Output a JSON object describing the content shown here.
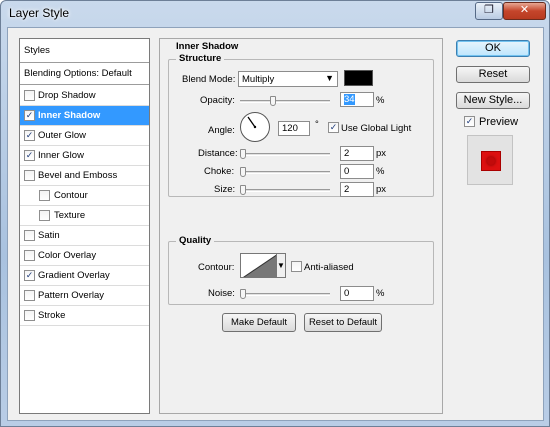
{
  "window": {
    "title": "Layer Style",
    "restore_icon": "restore-icon",
    "close_icon": "close-icon"
  },
  "styles": {
    "header": "Styles",
    "blending": "Blending Options: Default",
    "items": [
      {
        "label": "Drop Shadow",
        "checked": false
      },
      {
        "label": "Inner Shadow",
        "checked": true,
        "selected": true
      },
      {
        "label": "Outer Glow",
        "checked": true
      },
      {
        "label": "Inner Glow",
        "checked": true
      },
      {
        "label": "Bevel and Emboss",
        "checked": false
      },
      {
        "label": "Contour",
        "checked": false,
        "sub": true
      },
      {
        "label": "Texture",
        "checked": false,
        "sub": true
      },
      {
        "label": "Satin",
        "checked": false
      },
      {
        "label": "Color Overlay",
        "checked": false
      },
      {
        "label": "Gradient Overlay",
        "checked": true
      },
      {
        "label": "Pattern Overlay",
        "checked": false
      },
      {
        "label": "Stroke",
        "checked": false
      }
    ]
  },
  "panel": {
    "title": "Inner Shadow",
    "structure": {
      "title": "Structure",
      "blend_mode_label": "Blend Mode:",
      "blend_mode_value": "Multiply",
      "blend_color": "#000000",
      "opacity_label": "Opacity:",
      "opacity_value": "34",
      "opacity_unit": "%",
      "angle_label": "Angle:",
      "angle_value": "120",
      "angle_unit": "°",
      "use_global_light": "Use Global Light",
      "use_global_light_checked": true,
      "distance_label": "Distance:",
      "distance_value": "2",
      "distance_unit": "px",
      "choke_label": "Choke:",
      "choke_value": "0",
      "choke_unit": "%",
      "size_label": "Size:",
      "size_value": "2",
      "size_unit": "px"
    },
    "quality": {
      "title": "Quality",
      "contour_label": "Contour:",
      "anti_aliased": "Anti-aliased",
      "anti_aliased_checked": false,
      "noise_label": "Noise:",
      "noise_value": "0",
      "noise_unit": "%"
    },
    "make_default": "Make Default",
    "reset_to_default": "Reset to Default"
  },
  "buttons": {
    "ok": "OK",
    "reset": "Reset",
    "new_style": "New Style...",
    "preview": "Preview",
    "preview_checked": true
  },
  "colors": {
    "selection": "#3399ff",
    "preview_fill": "#dd1111"
  }
}
